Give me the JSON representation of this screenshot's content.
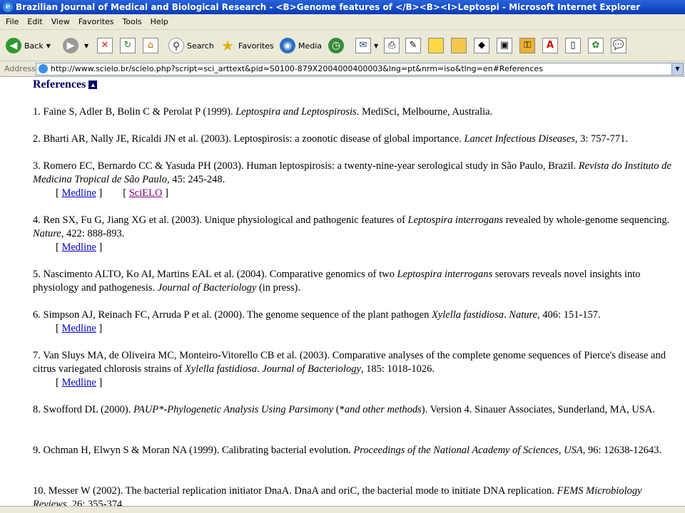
{
  "window": {
    "title": "Brazilian Journal of Medical and Biological Research - <B>Genome features of </B><B><I>Leptospi - Microsoft Internet Explorer"
  },
  "menu": [
    "File",
    "Edit",
    "View",
    "Favorites",
    "Tools",
    "Help"
  ],
  "toolbar": {
    "back": "Back",
    "search": "Search",
    "favorites": "Favorites",
    "media": "Media"
  },
  "address": {
    "label": "Address",
    "url": "http://www.scielo.br/scielo.php?script=sci_arttext&pid=S0100-879X2004000400003&lng=pt&nrm=iso&tlng=en#References"
  },
  "page": {
    "heading": "References",
    "refs": [
      {
        "a": "1. Faine S, Adler B, Bolin C & Perolat P (1999). ",
        "i": "Leptospira and Leptospirosis",
        "b": ". MediSci, Melbourne, Australia."
      },
      {
        "a": "2. Bharti AR, Nally JE, Ricaldi JN et al. (2003). Leptospirosis: a zoonotic disease of global importance. ",
        "i": "Lancet Infectious Diseases",
        "b": ", 3: 757-771."
      },
      {
        "a": "3. Romero EC, Bernardo CC & Yasuda PH (2003). Human leptospirosis: a twenty-nine-year serological study in São Paulo, Brazil. ",
        "i": "Revista do Instituto de Medicina Tropical de São Paulo",
        "b": ", 45: 245-248."
      },
      {
        "a": "4. Ren SX, Fu G, Jiang XG et al. (2003). Unique physiological and pathogenic features of ",
        "i": "Leptospira interrogans",
        "b": " revealed by whole-genome sequencing. ",
        "i2": "Nature",
        "c": ", 422: 888-893."
      },
      {
        "a": "5. Nascimento ALTO, Ko AI, Martins EAL et al. (2004). Comparative genomics of two ",
        "i": "Leptospira interrogans",
        "b": " serovars reveals novel insights into physiology and pathogenesis. ",
        "i2": "Journal of Bacteriology",
        "c": " (in press)."
      },
      {
        "a": "6. Simpson AJ, Reinach FC, Arruda P et al. (2000). The genome sequence of the plant pathogen ",
        "i": "Xylella fastidiosa",
        "b": ". ",
        "i2": "Nature",
        "c": ", 406: 151-157."
      },
      {
        "a": "7. Van Sluys MA, de Oliveira MC, Monteiro-Vitorello CB et al. (2003). Comparative analyses of the complete genome sequences of Pierce's disease and citrus variegated chlorosis strains of ",
        "i": "Xylella fastidiosa",
        "b": ". ",
        "i2": "Journal of Bacteriology",
        "c": ", 185: 1018-1026."
      },
      {
        "a": "8. Swofford DL (2000). ",
        "i": "PAUP*-Phylogenetic Analysis Using Parsimony",
        "b": " (*",
        "i2": "and other methods",
        "c": "). Version 4. Sinauer Associates, Sunderland, MA, USA."
      },
      {
        "a": "9. Ochman H, Elwyn S & Moran NA (1999). Calibrating bacterial evolution. ",
        "i": "Proceedings of the National Academy of Sciences, USA",
        "b": ", 96: 12638-12643."
      },
      {
        "a": "10. Messer W (2002). The bacterial replication initiator DnaA. DnaA and oriC, the bacterial mode to initiate DNA replication. ",
        "i": "FEMS Microbiology Reviews",
        "b": ", 26: 355-374."
      }
    ],
    "link_medline": "Medline",
    "link_scielo": "SciELO",
    "bracket_open": "[",
    "bracket_close": "]"
  },
  "colors": {
    "title_bar": "#0a3cb8",
    "link": "#0000cc",
    "visited": "#800080",
    "heading": "#000066"
  }
}
